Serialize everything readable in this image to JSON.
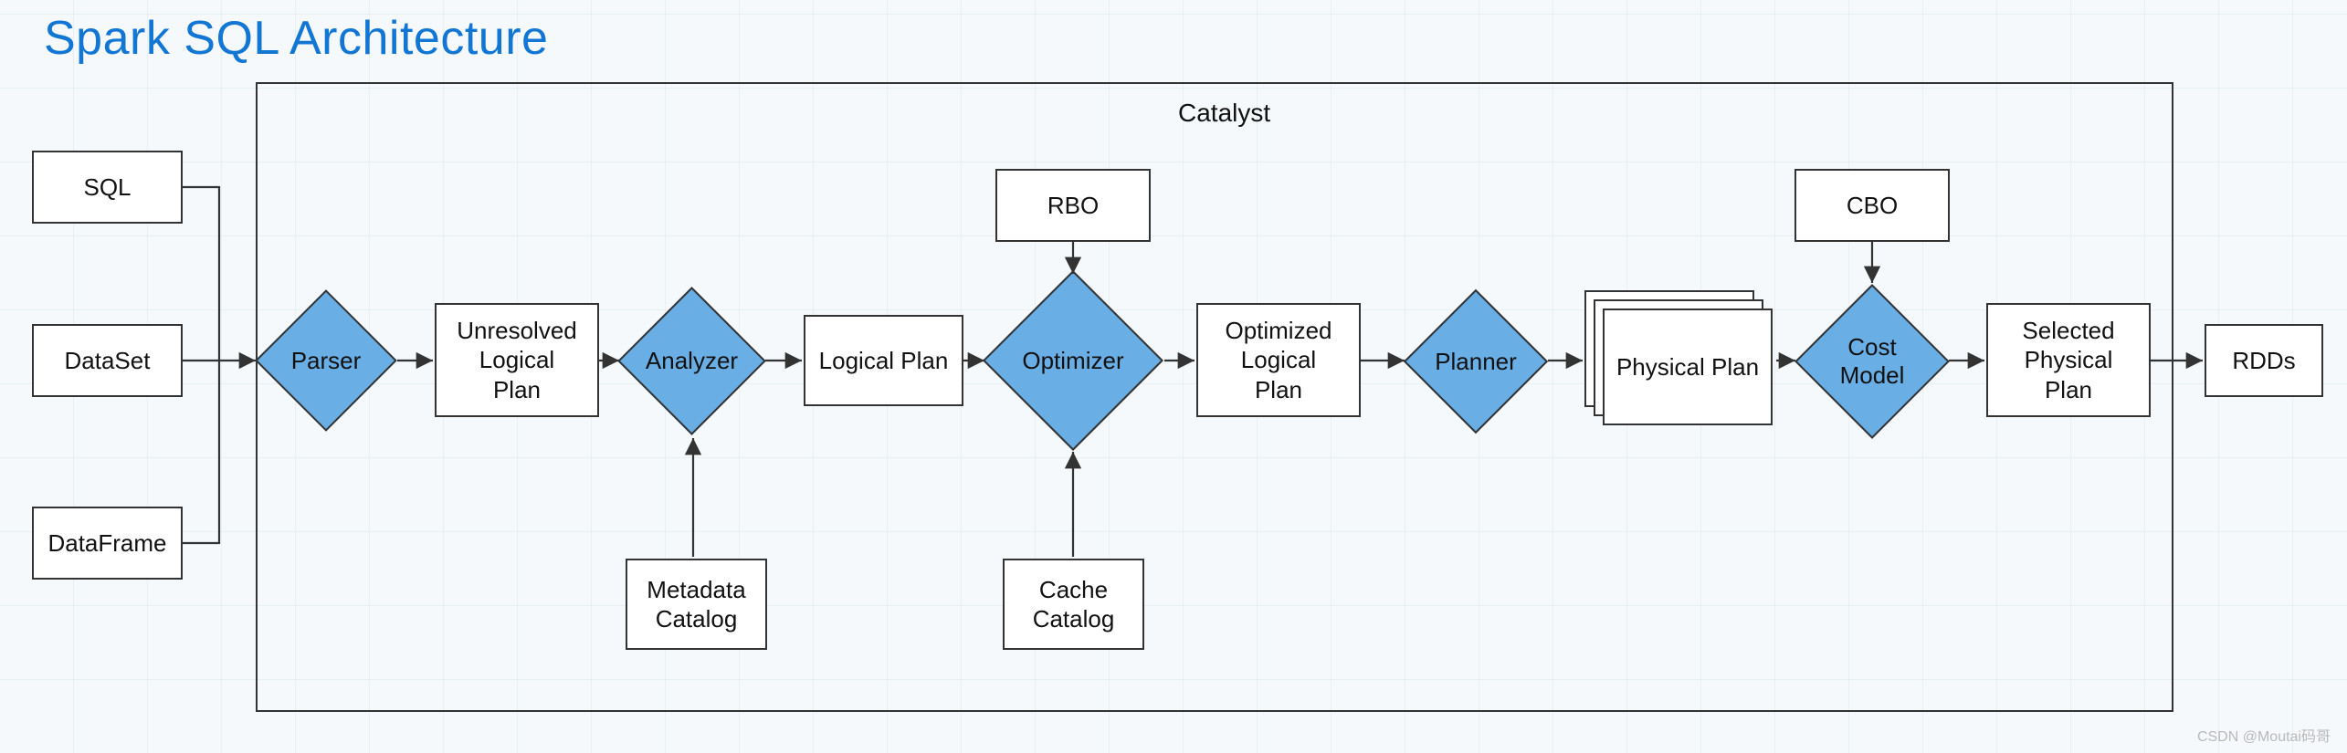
{
  "title": "Spark SQL Architecture",
  "catalyst_label": "Catalyst",
  "inputs": {
    "sql": "SQL",
    "dataset": "DataSet",
    "dataframe": "DataFrame"
  },
  "stages": {
    "parser": "Parser",
    "unresolved_logical_plan": "Unresolved\nLogical\nPlan",
    "analyzer": "Analyzer",
    "logical_plan": "Logical Plan",
    "optimizer": "Optimizer",
    "optimized_logical_plan": "Optimized\nLogical\nPlan",
    "planner": "Planner",
    "physical_plan": "Physical Plan",
    "cost_model": "Cost\nModel",
    "selected_physical_plan": "Selected\nPhysical\nPlan"
  },
  "aux": {
    "rbo": "RBO",
    "cbo": "CBO",
    "metadata_catalog": "Metadata\nCatalog",
    "cache_catalog": "Cache\nCatalog"
  },
  "output": {
    "rdds": "RDDs"
  },
  "colors": {
    "accent_blue": "#6aaee6",
    "title_blue": "#1176d4"
  },
  "watermark": "CSDN @Moutai码哥"
}
